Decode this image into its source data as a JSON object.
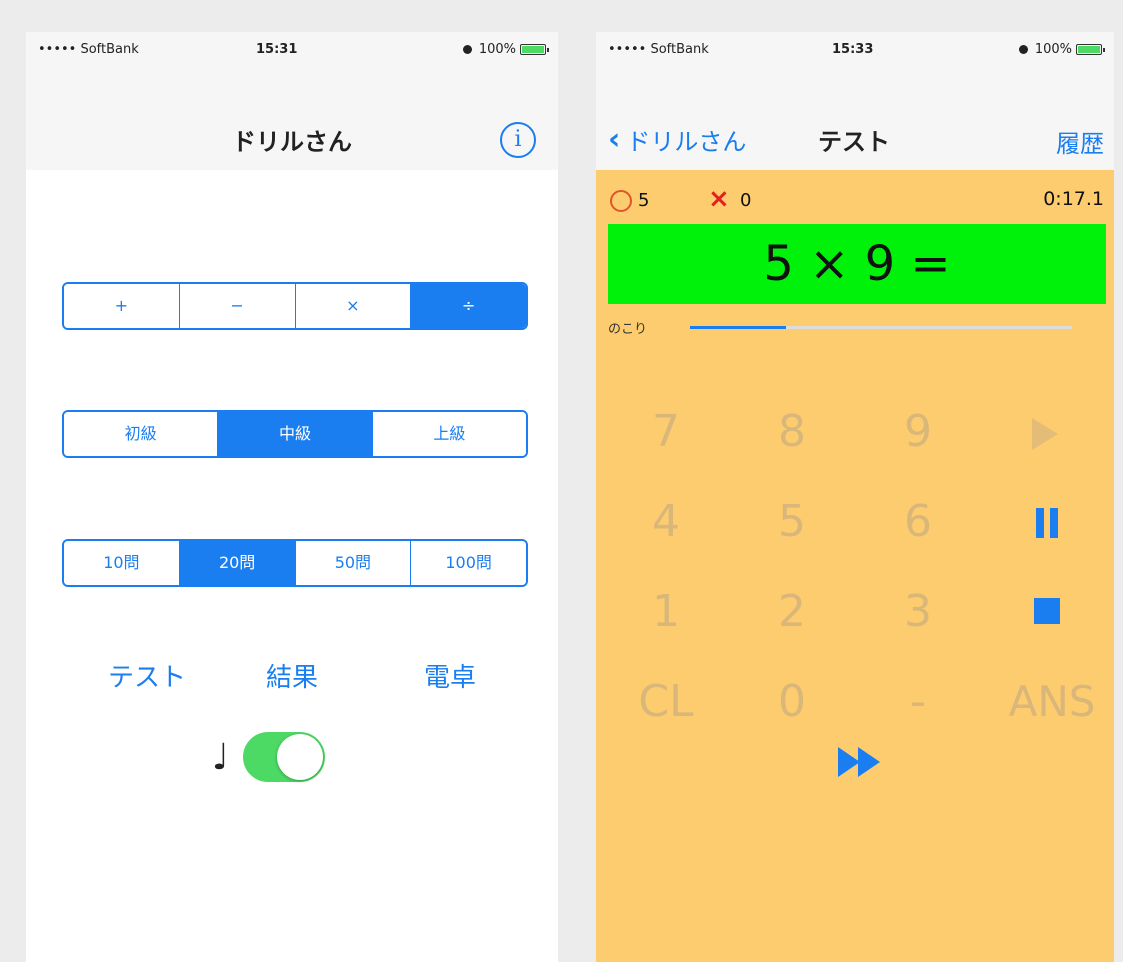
{
  "left": {
    "status": {
      "carrier": "••••• SoftBank",
      "time": "15:31",
      "battery": "100%"
    },
    "title": "ドリルさん",
    "info_label": "i",
    "operations": [
      "+",
      "−",
      "×",
      "÷"
    ],
    "operations_selected": "÷",
    "levels": [
      "初級",
      "中級",
      "上級"
    ],
    "levels_selected": "中級",
    "counts": [
      "10問",
      "20問",
      "50問",
      "100問"
    ],
    "counts_selected": "20問",
    "actions": {
      "test": "テスト",
      "result": "結果",
      "calculator": "電卓"
    },
    "sound_icon": "♩",
    "sound_on": true
  },
  "right": {
    "status": {
      "carrier": "••••• SoftBank",
      "time": "15:33",
      "battery": "100%"
    },
    "back_label": "ドリルさん",
    "title": "テスト",
    "history_label": "履歴",
    "correct": "5",
    "wrong": "0",
    "timer": "0:17.1",
    "question": "5 × 9 =",
    "remain_label": "のこり",
    "remain_fraction": 0.25,
    "keys": {
      "row1": [
        "7",
        "8",
        "9"
      ],
      "row2": [
        "4",
        "5",
        "6"
      ],
      "row3": [
        "1",
        "2",
        "3"
      ],
      "row4": [
        "CL",
        "0",
        "-",
        "ANS"
      ]
    }
  },
  "colors": {
    "accent": "#1a7ef0",
    "toggle_on": "#4cd964",
    "test_background": "#fdcc6e",
    "question_background": "#00f20a",
    "wrong_mark": "#e41f1f",
    "correct_mark": "#e0552b"
  }
}
